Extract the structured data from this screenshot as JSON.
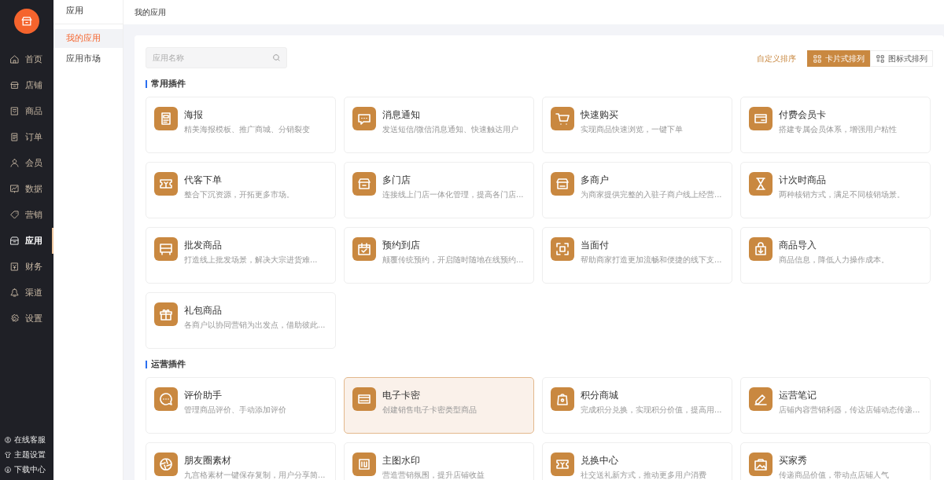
{
  "nav": {
    "items": [
      {
        "label": "首页",
        "selected": false
      },
      {
        "label": "店铺",
        "selected": false
      },
      {
        "label": "商品",
        "selected": false
      },
      {
        "label": "订单",
        "selected": false
      },
      {
        "label": "会员",
        "selected": false
      },
      {
        "label": "数据",
        "selected": false
      },
      {
        "label": "营销",
        "selected": false
      },
      {
        "label": "应用",
        "selected": true
      },
      {
        "label": "财务",
        "selected": false
      },
      {
        "label": "渠道",
        "selected": false
      },
      {
        "label": "设置",
        "selected": false
      }
    ],
    "footer": [
      {
        "label": "在线客服"
      },
      {
        "label": "主题设置"
      },
      {
        "label": "下载中心"
      }
    ]
  },
  "subnav": {
    "title": "应用",
    "items": [
      {
        "label": "我的应用",
        "selected": true
      },
      {
        "label": "应用市场",
        "selected": false
      }
    ]
  },
  "header": {
    "title": "我的应用"
  },
  "search": {
    "placeholder": "应用名称"
  },
  "custom_sort": "自定义排序",
  "view_toggle": [
    {
      "label": "卡片式排列",
      "selected": true
    },
    {
      "label": "图标式排列",
      "selected": false
    }
  ],
  "sections": [
    {
      "title": "常用插件",
      "cards": [
        {
          "title": "海报",
          "desc": "精美海报模板、推广商城、分销裂变",
          "highlighted": false
        },
        {
          "title": "消息通知",
          "desc": "发送短信/微信消息通知、快速触达用户",
          "highlighted": false
        },
        {
          "title": "快速购买",
          "desc": "实现商品快速浏览，一键下单",
          "highlighted": false
        },
        {
          "title": "付费会员卡",
          "desc": "搭建专属会员体系，增强用户粘性",
          "highlighted": false
        },
        {
          "title": "代客下单",
          "desc": "整合下沉资源，开拓更多市场。",
          "highlighted": false
        },
        {
          "title": "多门店",
          "desc": "连接线上门店一体化管理，提高各门店...",
          "highlighted": false
        },
        {
          "title": "多商户",
          "desc": "为商家提供完整的入驻子商户线上经营...",
          "highlighted": false
        },
        {
          "title": "计次时商品",
          "desc": "两种核销方式，满足不同核销场景。",
          "highlighted": false
        },
        {
          "title": "批发商品",
          "desc": "打造线上批发场景，解决大宗进货难...",
          "highlighted": false
        },
        {
          "title": "预约到店",
          "desc": "颠覆传统预约，开启随时随地在线预约...",
          "highlighted": false
        },
        {
          "title": "当面付",
          "desc": "帮助商家打造更加流畅和便捷的线下支...",
          "highlighted": false
        },
        {
          "title": "商品导入",
          "desc": "商品信息，降低人力操作成本。",
          "highlighted": false
        },
        {
          "title": "礼包商品",
          "desc": "各商户以协同营销为出发点，借助彼此...",
          "highlighted": false
        }
      ]
    },
    {
      "title": "运营插件",
      "cards": [
        {
          "title": "评价助手",
          "desc": "管理商品评价、手动添加评价",
          "highlighted": false
        },
        {
          "title": "电子卡密",
          "desc": "创建销售电子卡密类型商品",
          "highlighted": true
        },
        {
          "title": "积分商城",
          "desc": "完成积分兑换，实现积分价值，提高用...",
          "highlighted": false
        },
        {
          "title": "运营笔记",
          "desc": "店铺内容营销利器，传达店铺动态传递...",
          "highlighted": false
        },
        {
          "title": "朋友圈素材",
          "desc": "九宫格素材一键保存复制，用户分享简...",
          "highlighted": false
        },
        {
          "title": "主图水印",
          "desc": "营造营销氛围，提升店铺收益",
          "highlighted": false
        },
        {
          "title": "兑换中心",
          "desc": "社交送礼新方式，推动更多用户消费",
          "highlighted": false
        },
        {
          "title": "买家秀",
          "desc": "传递商品价值，带动点店铺人气",
          "highlighted": false
        }
      ]
    }
  ]
}
